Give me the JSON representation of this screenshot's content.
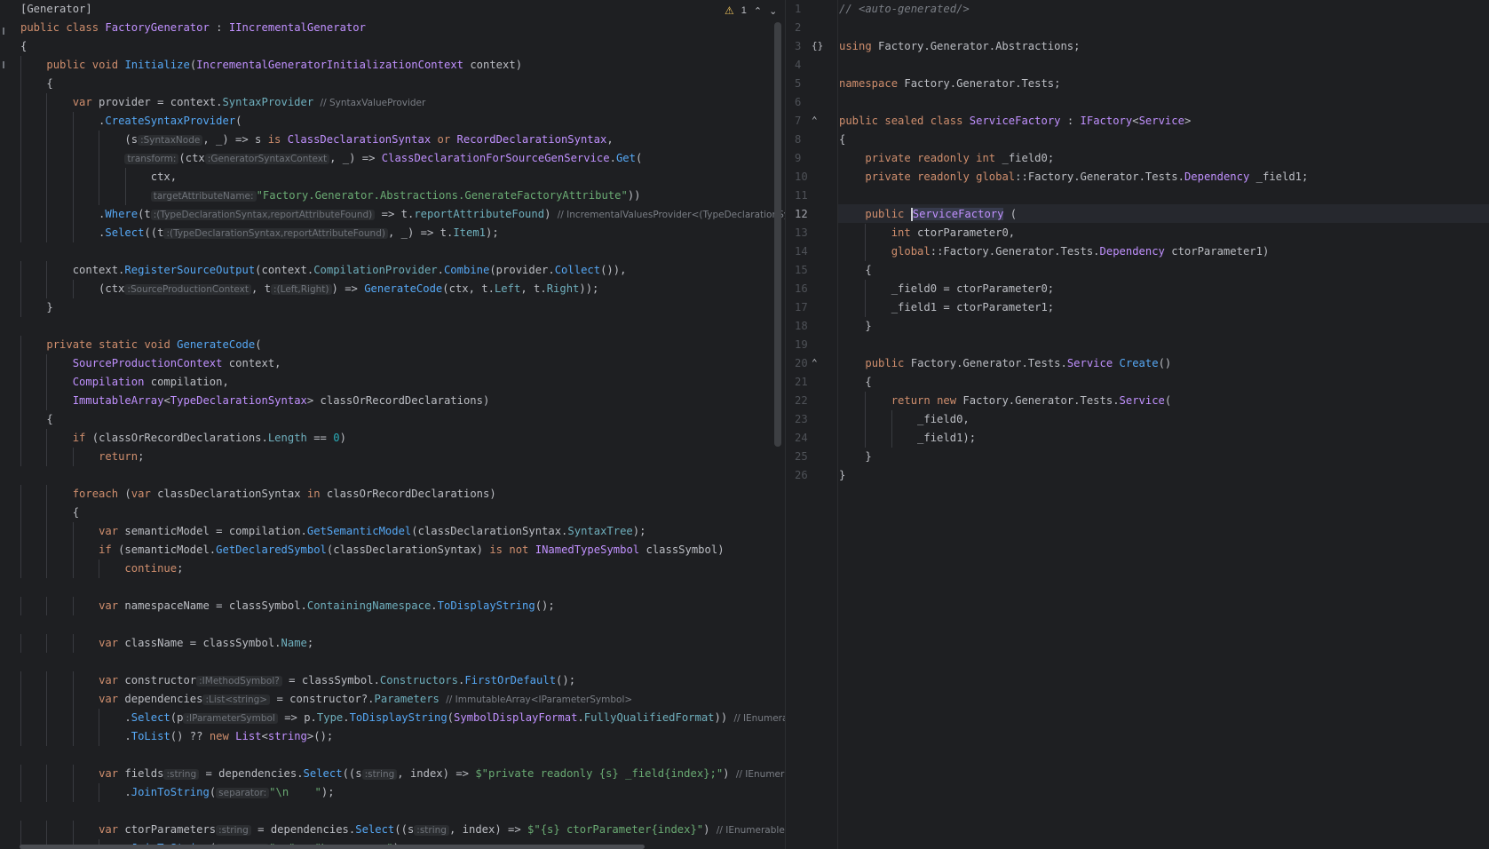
{
  "left_editor": {
    "warnings_count": "1",
    "lines": [
      [
        "[Generator]"
      ],
      [
        "public class FactoryGenerator : IIncrementalGenerator"
      ],
      [
        "{"
      ],
      [
        "    public void Initialize(IncrementalGeneratorInitializationContext context)"
      ],
      [
        "    {"
      ],
      [
        "        var provider = context.SyntaxProvider",
        "// SyntaxValueProvider"
      ],
      [
        "            .CreateSyntaxProvider("
      ],
      [
        "                (s",
        ":SyntaxNode",
        ", _) => s is ClassDeclarationSyntax or RecordDeclarationSyntax,"
      ],
      [
        "                ",
        "transform:",
        "(ctx",
        ":GeneratorSyntaxContext",
        ", _) => ClassDeclarationForSourceGenService.Get("
      ],
      [
        "                    ctx,"
      ],
      [
        "                    ",
        "targetAttributeName:",
        "\"Factory.Generator.Abstractions.GenerateFactoryAttribute\"))"
      ],
      [
        "            .Where(t",
        ":(TypeDeclarationSyntax,reportAttributeFound)",
        " => t.reportAttributeFound)",
        "// IncrementalValuesProvider<(TypeDeclarationSynta"
      ],
      [
        "            .Select((t",
        ":(TypeDeclarationSyntax,reportAttributeFound)",
        ", _) => t.Item1);"
      ],
      [
        ""
      ],
      [
        "        context.RegisterSourceOutput(context.CompilationProvider.Combine(provider.Collect()),"
      ],
      [
        "            (ctx",
        ":SourceProductionContext",
        ", t",
        ":(Left,Right)",
        ") => GenerateCode(ctx, t.Left, t.Right));"
      ],
      [
        "    }"
      ],
      [
        ""
      ],
      [
        "    private static void GenerateCode("
      ],
      [
        "        SourceProductionContext context,"
      ],
      [
        "        Compilation compilation,"
      ],
      [
        "        ImmutableArray<TypeDeclarationSyntax> classOrRecordDeclarations)"
      ],
      [
        "    {"
      ],
      [
        "        if (classOrRecordDeclarations.Length == 0)"
      ],
      [
        "            return;"
      ],
      [
        ""
      ],
      [
        "        foreach (var classDeclarationSyntax in classOrRecordDeclarations)"
      ],
      [
        "        {"
      ],
      [
        "            var semanticModel = compilation.GetSemanticModel(classDeclarationSyntax.SyntaxTree);"
      ],
      [
        "            if (semanticModel.GetDeclaredSymbol(classDeclarationSyntax) is not INamedTypeSymbol classSymbol)"
      ],
      [
        "                continue;"
      ],
      [
        ""
      ],
      [
        "            var namespaceName = classSymbol.ContainingNamespace.ToDisplayString();"
      ],
      [
        ""
      ],
      [
        "            var className = classSymbol.Name;"
      ],
      [
        ""
      ],
      [
        "            var constructor",
        ":IMethodSymbol?",
        " = classSymbol.Constructors.FirstOrDefault();"
      ],
      [
        "            var dependencies",
        ":List<string>",
        " = constructor?.Parameters",
        "// ImmutableArray<IParameterSymbol>"
      ],
      [
        "                .Select(p",
        ":IParameterSymbol",
        " => p.Type.ToDisplayString(SymbolDisplayFormat.FullyQualifiedFormat))",
        "// IEnumerable<str"
      ],
      [
        "                .ToList() ?? new List<string>();"
      ],
      [
        ""
      ],
      [
        "            var fields",
        ":string",
        " = dependencies.Select((s",
        ":string",
        ", index) => $\"private readonly {s} _field{index};\")",
        "// IEnumerable<s"
      ],
      [
        "                .JoinToString(",
        "separator:",
        "\"\\n    \");"
      ],
      [
        ""
      ],
      [
        "            var ctorParameters",
        ":string",
        " = dependencies.Select((s",
        ":string",
        ", index) => $\"{s} ctorParameter{index}\")",
        "// IEnumerable<string"
      ],
      [
        "                .JoinToString(",
        "separator:",
        "\", \" + \"\\n        \");"
      ]
    ]
  },
  "right_editor": {
    "line_numbers": [
      "1",
      "2",
      "3",
      "4",
      "5",
      "6",
      "7",
      "8",
      "9",
      "10",
      "11",
      "12",
      "13",
      "14",
      "15",
      "16",
      "17",
      "18",
      "19",
      "20",
      "21",
      "22",
      "23",
      "24",
      "25",
      "26"
    ],
    "lines": [
      "// <auto-generated/>",
      "",
      "using Factory.Generator.Abstractions;",
      "",
      "namespace Factory.Generator.Tests;",
      "",
      "public sealed class ServiceFactory : IFactory<Service>",
      "{",
      "    private readonly int _field0;",
      "    private readonly global::Factory.Generator.Tests.Dependency _field1;",
      "",
      "    public ServiceFactory (",
      "        int ctorParameter0,",
      "        global::Factory.Generator.Tests.Dependency ctorParameter1)",
      "    {",
      "        _field0 = ctorParameter0;",
      "        _field1 = ctorParameter1;",
      "    }",
      "",
      "    public Factory.Generator.Tests.Service Create()",
      "    {",
      "        return new Factory.Generator.Tests.Service(",
      "            _field0,",
      "            _field1);",
      "    }",
      "}"
    ],
    "braces_icon": "{}",
    "active_line": "12"
  },
  "icons": {
    "warning": "warning-triangle-icon",
    "prev": "chevron-up-icon",
    "next": "chevron-down-icon",
    "implements": "implements-gutter-icon"
  }
}
